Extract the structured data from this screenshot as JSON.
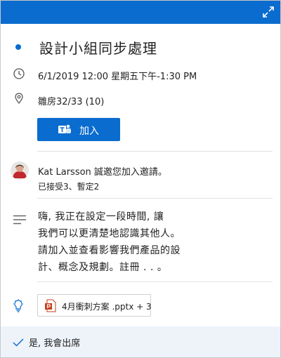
{
  "event": {
    "title": "設計小組同步處理",
    "datetime": "6/1/2019 12:00 星期五下午-1:30 PM",
    "location": "雛房32/33 (10)"
  },
  "join_button": {
    "label": "加入"
  },
  "invite": {
    "message": "Kat Larsson 誠邀您加入邀請。",
    "status": "已接受3、暫定2"
  },
  "notes": {
    "lines": [
      "嗨, 我正在設定一段時間, 讓",
      "我們可以更清楚地認識其他人。",
      "請加入並查看影響我們產品的設",
      "計、概念及規劃。註冊 . . 。"
    ]
  },
  "attachment": {
    "label": "4月衝刺方案 .pptx + 3"
  },
  "footer": {
    "response": "是, 我會出席"
  },
  "colors": {
    "accent": "#0a6ccf",
    "footer_bg": "#eef3fa",
    "ppt_red": "#c43e1c"
  },
  "icons": [
    "expand-icon",
    "clock-icon",
    "location-pin-icon",
    "teams-icon",
    "notes-icon",
    "lightbulb-icon",
    "powerpoint-icon",
    "checkmark-icon"
  ]
}
